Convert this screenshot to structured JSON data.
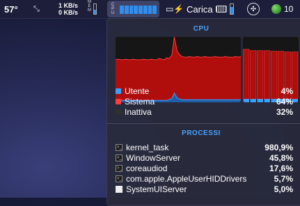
{
  "menubar": {
    "temperature": "57°",
    "net_up": "1 KB/s",
    "net_down": "0 KB/s",
    "mem_label": "MEM",
    "cpu_label": "CPU",
    "cpu_core_levels": [
      0.85,
      0.85,
      0.85,
      0.85,
      0.85,
      0.85,
      0.85,
      0.85
    ],
    "battery_text": "Carica",
    "clock_text": "10"
  },
  "cpu_panel": {
    "title": "CPU",
    "colors": {
      "user": "#3aa0ff",
      "system": "#ff3b3b",
      "inactive": "#303030"
    },
    "history": {
      "system_fraction": [
        0.62,
        0.63,
        0.62,
        0.62,
        0.63,
        0.62,
        0.62,
        0.63,
        0.62,
        0.62,
        0.62,
        0.63,
        0.62,
        0.62,
        0.63,
        0.62,
        0.62,
        0.64,
        0.63,
        0.62,
        0.65,
        0.63,
        0.66,
        0.86,
        0.72,
        0.68,
        0.66,
        0.65,
        0.65,
        0.66,
        0.65,
        0.65,
        0.66,
        0.65,
        0.65,
        0.66,
        0.65,
        0.65,
        0.65,
        0.66,
        0.65,
        0.65,
        0.65,
        0.66,
        0.65,
        0.65,
        0.65,
        0.66,
        0.65,
        0.66
      ],
      "user_fraction": [
        0.03,
        0.03,
        0.03,
        0.03,
        0.03,
        0.03,
        0.03,
        0.03,
        0.03,
        0.03,
        0.03,
        0.03,
        0.03,
        0.03,
        0.03,
        0.03,
        0.03,
        0.03,
        0.03,
        0.03,
        0.03,
        0.04,
        0.06,
        0.14,
        0.07,
        0.05,
        0.04,
        0.04,
        0.04,
        0.04,
        0.04,
        0.04,
        0.04,
        0.04,
        0.04,
        0.04,
        0.04,
        0.04,
        0.04,
        0.04,
        0.04,
        0.04,
        0.04,
        0.04,
        0.04,
        0.04,
        0.04,
        0.04,
        0.04,
        0.04
      ]
    },
    "cores": [
      {
        "system": 0.76,
        "user": 0.05
      },
      {
        "system": 0.74,
        "user": 0.05
      },
      {
        "system": 0.74,
        "user": 0.05
      },
      {
        "system": 0.74,
        "user": 0.05
      },
      {
        "system": 0.73,
        "user": 0.05
      },
      {
        "system": 0.73,
        "user": 0.05
      },
      {
        "system": 0.72,
        "user": 0.05
      },
      {
        "system": 0.72,
        "user": 0.05
      }
    ],
    "legend": [
      {
        "label": "Utente",
        "value": "4%",
        "key": "user"
      },
      {
        "label": "Sistema",
        "value": "64%",
        "key": "system"
      },
      {
        "label": "Inattiva",
        "value": "32%",
        "key": "inactive"
      }
    ]
  },
  "process_panel": {
    "title": "PROCESSI",
    "processes": [
      {
        "name": "kernel_task",
        "value": "980,9%"
      },
      {
        "name": "WindowServer",
        "value": "45,8%"
      },
      {
        "name": "coreaudiod",
        "value": "17,6%"
      },
      {
        "name": "com.apple.AppleUserHIDDrivers",
        "value": "5,7%"
      },
      {
        "name": "SystemUIServer",
        "value": "5,0%"
      }
    ]
  }
}
